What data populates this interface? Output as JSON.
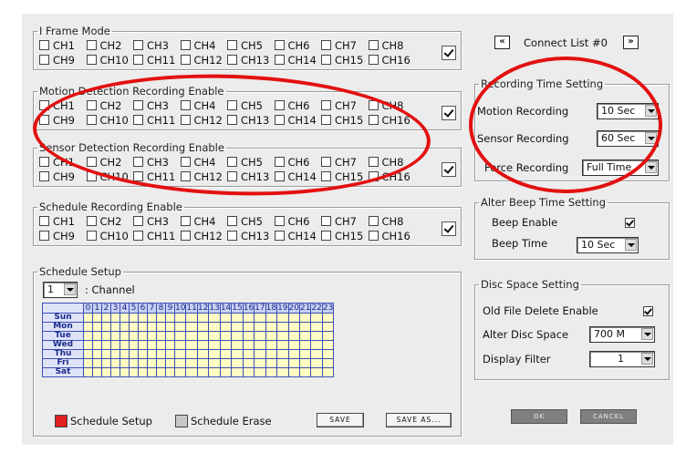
{
  "channels_row1": [
    "CH1",
    "CH2",
    "CH3",
    "CH4",
    "CH5",
    "CH6",
    "CH7",
    "CH8"
  ],
  "channels_row2": [
    "CH9",
    "CH10",
    "CH11",
    "CH12",
    "CH13",
    "CH14",
    "CH15",
    "CH16"
  ],
  "groups": {
    "iframe": "I Frame Mode",
    "motion": "Motion Detection Recording Enable",
    "sensor": "Sensor Detection Recording Enable",
    "schedule_enable": "Schedule Recording Enable",
    "schedule_setup": "Schedule Setup",
    "recording_time": "Recording Time Setting",
    "alter_beep": "Alter Beep Time Setting",
    "disc_space": "Disc Space Setting"
  },
  "connect_list": {
    "prev": "«",
    "label": "Connect List #0",
    "next": "»"
  },
  "recording_time": {
    "motion_label": "Motion Recording",
    "motion_value": "10 Sec",
    "sensor_label": "Sensor Recording",
    "sensor_value": "60 Sec",
    "force_label": "Force Recording",
    "force_value": "Full Time"
  },
  "beep": {
    "enable_label": "Beep Enable",
    "time_label": "Beep Time",
    "time_value": "10 Sec"
  },
  "disc": {
    "old_delete_label": "Old File Delete Enable",
    "alter_label": "Alter Disc Space",
    "alter_value": "700 M",
    "filter_label": "Display Filter",
    "filter_value": "1"
  },
  "schedule": {
    "channel_value": "1",
    "channel_label": ": Channel",
    "hours": [
      "0",
      "1",
      "2",
      "3",
      "4",
      "5",
      "6",
      "7",
      "8",
      "9",
      "10",
      "11",
      "12",
      "13",
      "14",
      "15",
      "16",
      "17",
      "18",
      "19",
      "20",
      "21",
      "22",
      "23"
    ],
    "days": [
      "Sun",
      "Mon",
      "Tue",
      "Wed",
      "Thu",
      "Fri",
      "Sat"
    ],
    "setup_label": "Schedule Setup",
    "erase_label": "Schedule Erase",
    "save": "SAVE",
    "save_as": "SAVE AS..."
  },
  "buttons": {
    "ok": "OK",
    "cancel": "CANCEL"
  },
  "colors": {
    "grid_header": "#3b50b5",
    "grid_cell": "#fefcc4",
    "setup_swatch": "#e02020",
    "erase_swatch": "#c8c8c8",
    "annotation": "#e31010"
  }
}
